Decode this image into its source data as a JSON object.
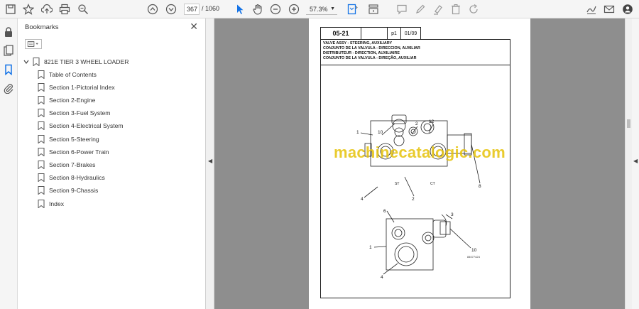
{
  "toolbar": {
    "current_page": "367",
    "page_separator_total": "/  1060",
    "zoom": "57.3%"
  },
  "panel": {
    "title": "Bookmarks",
    "close_glyph": "✕",
    "bookmarks": [
      {
        "label": "821E TIER 3 WHEEL LOADER",
        "level": 0
      },
      {
        "label": "Table of Contents",
        "level": 1
      },
      {
        "label": "Section 1-Pictorial Index",
        "level": 1
      },
      {
        "label": "Section 2-Engine",
        "level": 1
      },
      {
        "label": "Section 3-Fuel System",
        "level": 1
      },
      {
        "label": "Section 4-Electrical System",
        "level": 1
      },
      {
        "label": "Section 5-Steering",
        "level": 1
      },
      {
        "label": "Section 6-Power Train",
        "level": 1
      },
      {
        "label": "Section 7-Brakes",
        "level": 1
      },
      {
        "label": "Section 8-Hydraulics",
        "level": 1
      },
      {
        "label": "Section 9-Chassis",
        "level": 1
      },
      {
        "label": "Index",
        "level": 1
      }
    ]
  },
  "document": {
    "section_code": "05-21",
    "page_code": "p1",
    "date_code": "01/09",
    "title_lines": [
      "VALVE ASSY - STEERING, AUXILIARY",
      "CONJUNTO DE LA VALVULA - DIRECCION, AUXILIAR",
      "DISTRIBUTEUR - DIRECTION, AUXILIAIRE",
      "CONJUNTO DE LA VALVULA - DIREÇÃO, AUXILIAR"
    ],
    "watermark": "machinecatalogic.com",
    "ref_code": "84077424",
    "callouts_top": [
      "1",
      "10",
      "2",
      "12",
      "4",
      "2",
      "8"
    ],
    "callouts_bottom": [
      "6",
      "3",
      "1",
      "4",
      "10"
    ],
    "port_labels": [
      "ST",
      "CT"
    ]
  },
  "icons": {
    "accent": "#1473e6",
    "toolbar": [
      "save-icon",
      "star-icon",
      "upload-icon",
      "print-icon",
      "zoom-search-icon",
      "page-up-icon",
      "page-down-icon",
      "cursor-icon",
      "hand-icon",
      "zoom-out-icon",
      "zoom-in-icon",
      "fit-page-icon",
      "scroll-mode-icon",
      "comment-icon",
      "pen-icon",
      "highlight-icon",
      "delete-icon",
      "rotate-icon",
      "sign-icon",
      "mail-icon",
      "account-icon"
    ]
  }
}
